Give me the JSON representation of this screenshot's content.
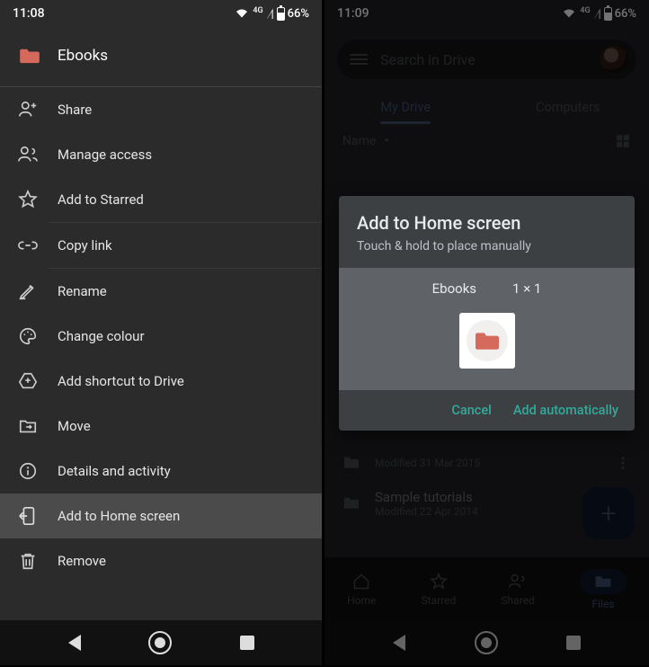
{
  "left": {
    "status": {
      "time": "11:08",
      "net_label": "4G",
      "battery_pct": "66%"
    },
    "folder": {
      "name": "Ebooks"
    },
    "menu": [
      {
        "id": "share",
        "label": "Share",
        "icon": "person-plus-icon"
      },
      {
        "id": "access",
        "label": "Manage access",
        "icon": "people-icon"
      },
      {
        "id": "star",
        "label": "Add to Starred",
        "icon": "star-icon"
      },
      {
        "id": "copy",
        "label": "Copy link",
        "icon": "link-icon"
      },
      {
        "id": "rename",
        "label": "Rename",
        "icon": "pencil-icon"
      },
      {
        "id": "colour",
        "label": "Change colour",
        "icon": "palette-icon"
      },
      {
        "id": "shortcut",
        "label": "Add shortcut to Drive",
        "icon": "drive-shortcut-icon"
      },
      {
        "id": "move",
        "label": "Move",
        "icon": "move-folder-icon"
      },
      {
        "id": "details",
        "label": "Details and activity",
        "icon": "info-icon"
      },
      {
        "id": "homescr",
        "label": "Add to Home screen",
        "icon": "add-to-homescreen-icon",
        "highlight": true
      },
      {
        "id": "remove",
        "label": "Remove",
        "icon": "trash-icon"
      }
    ]
  },
  "right": {
    "status": {
      "time": "11:09",
      "net_label": "4G",
      "battery_pct": "66%"
    },
    "search": {
      "placeholder": "Search in Drive"
    },
    "tabs": {
      "active": "My Drive",
      "other": "Computers"
    },
    "sort": {
      "label": "Name",
      "dir": "asc"
    },
    "files": [
      {
        "name": "",
        "modified": "Modified 31 Mar 2015"
      },
      {
        "name": "Sample tutorials",
        "modified": "Modified 22 Apr 2014"
      }
    ],
    "dialog": {
      "title": "Add to Home screen",
      "subtitle": "Touch & hold to place manually",
      "widget_name": "Ebooks",
      "widget_size": "1 × 1",
      "cancel": "Cancel",
      "confirm": "Add automatically"
    },
    "bottom_tabs": {
      "home": "Home",
      "starred": "Starred",
      "shared": "Shared",
      "files": "Files"
    }
  }
}
